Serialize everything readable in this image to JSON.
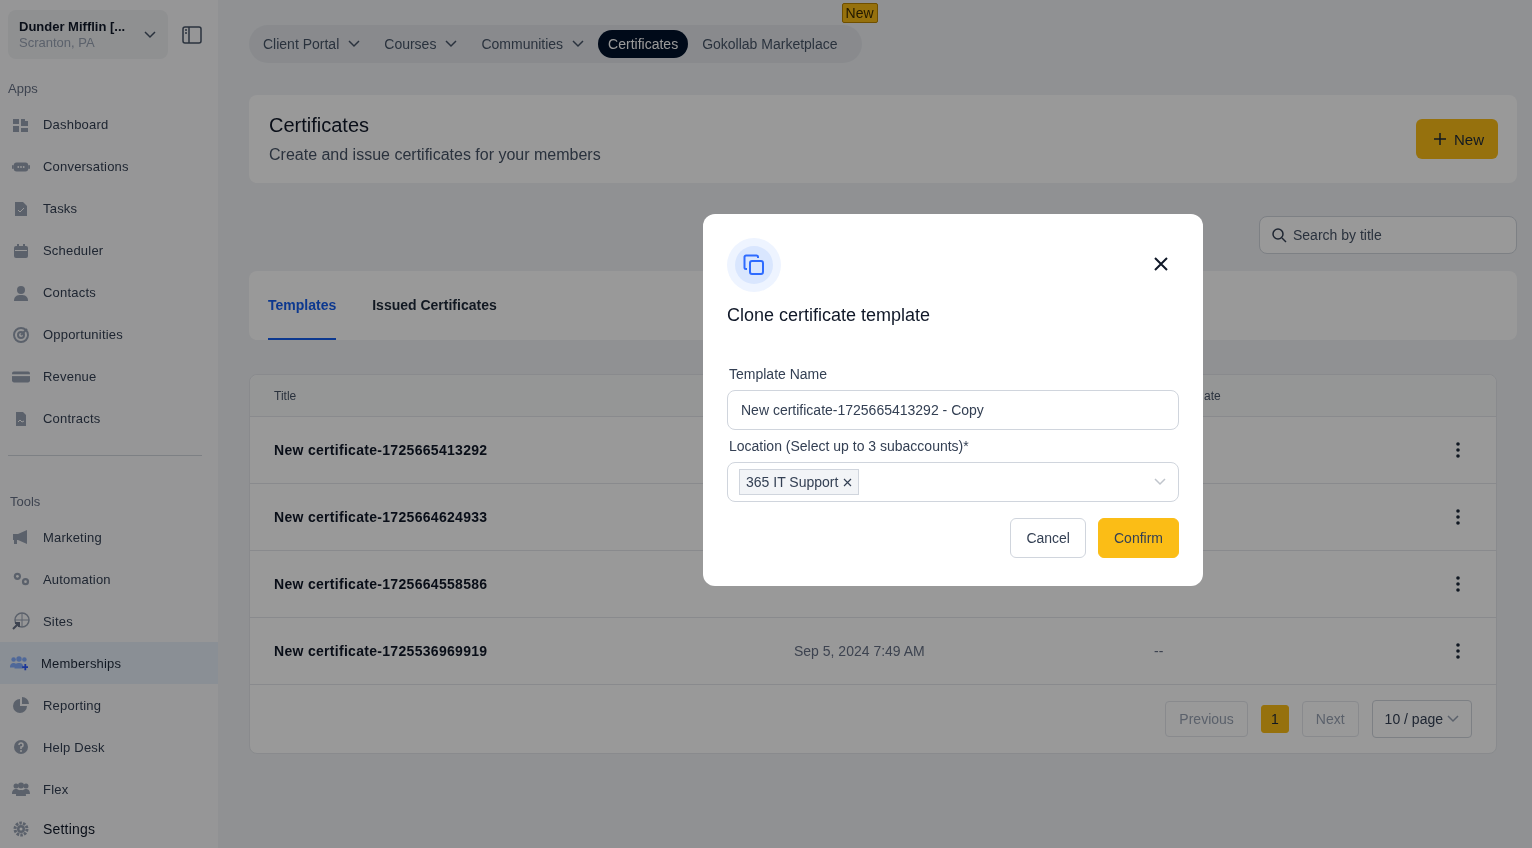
{
  "account": {
    "name": "Dunder Mifflin [...",
    "location": "Scranton, PA"
  },
  "sidebar": {
    "sections": [
      {
        "heading": "Apps",
        "items": [
          {
            "label": "Dashboard",
            "selected": false
          },
          {
            "label": "Conversations",
            "selected": false
          },
          {
            "label": "Tasks",
            "selected": false
          },
          {
            "label": "Scheduler",
            "selected": false
          },
          {
            "label": "Contacts",
            "selected": false
          },
          {
            "label": "Opportunities",
            "selected": false
          },
          {
            "label": "Revenue",
            "selected": false
          },
          {
            "label": "Contracts",
            "selected": false
          }
        ]
      },
      {
        "heading": "Tools",
        "items": [
          {
            "label": "Marketing",
            "selected": false
          },
          {
            "label": "Automation",
            "selected": false
          },
          {
            "label": "Sites",
            "selected": false
          },
          {
            "label": "Memberships",
            "selected": true
          },
          {
            "label": "Reporting",
            "selected": false
          },
          {
            "label": "Help Desk",
            "selected": false
          },
          {
            "label": "Flex",
            "selected": false
          }
        ]
      }
    ],
    "footer_item": {
      "label": "Settings"
    }
  },
  "top_nav": [
    {
      "label": "Client Portal",
      "dropdown": true,
      "selected": false
    },
    {
      "label": "Courses",
      "dropdown": true,
      "selected": false
    },
    {
      "label": "Communities",
      "dropdown": true,
      "selected": false
    },
    {
      "label": "Certificates",
      "dropdown": false,
      "selected": true
    },
    {
      "label": "Gokollab Marketplace",
      "dropdown": false,
      "selected": false,
      "badge": "New"
    }
  ],
  "header": {
    "title": "Certificates",
    "subtitle": "Create and issue certificates for your members",
    "new_button": "New"
  },
  "search": {
    "placeholder": "Search by title"
  },
  "tabs": [
    {
      "label": "Templates",
      "selected": true
    },
    {
      "label": "Issued Certificates",
      "selected": false
    }
  ],
  "table": {
    "columns": {
      "column_1": "Title",
      "column_3": "ate"
    },
    "rows": [
      {
        "title": "New certificate-1725665413292"
      },
      {
        "title": "New certificate-1725664624933"
      },
      {
        "title": "New certificate-1725664558586"
      },
      {
        "title": "New certificate-1725536969919",
        "column_2": "Sep 5, 2024 7:49 AM",
        "column_3": "--"
      }
    ],
    "pagination": {
      "previous": {
        "label": "Previous",
        "disabled": true
      },
      "pages": [
        {
          "label": "1",
          "selected": true
        }
      ],
      "next": {
        "label": "Next",
        "disabled": true
      },
      "page_size": "10 / page"
    }
  },
  "modal": {
    "title": "Clone certificate template",
    "name_label": "Template Name",
    "name_value": "New certificate-1725665413292 - Copy",
    "location_label": "Location (Select up to 3 subaccounts)*",
    "tags": [
      "365 IT Support"
    ],
    "cancel": "Cancel",
    "confirm": "Confirm"
  }
}
